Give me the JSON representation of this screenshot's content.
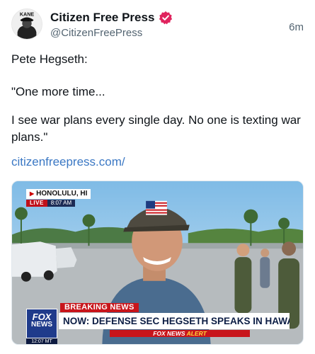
{
  "post": {
    "author_name": "Citizen Free Press",
    "author_handle": "@CitizenFreePress",
    "timestamp": "6m",
    "avatar_text": "KANE",
    "verified_color": "#e0245e",
    "text_lines": [
      "Pete Hegseth:",
      "\"One more time...",
      "I see war plans every single day. No one is texting war plans.\""
    ],
    "link": "citizenfreepress.com/",
    "link_color": "#3b78c4"
  },
  "video": {
    "location": "HONOLULU, HI",
    "live_label": "LIVE",
    "live_time": "8:07 AM",
    "breaking_label": "BREAKING NEWS",
    "headline": "NOW: DEFENSE SEC HEGSETH SPEAKS IN HAWAII",
    "alert_prefix": "FOX NEWS",
    "alert_word": "ALERT",
    "logo_top": "FOX",
    "logo_bottom": "NEWS",
    "logo_time": "12:07 MT"
  }
}
